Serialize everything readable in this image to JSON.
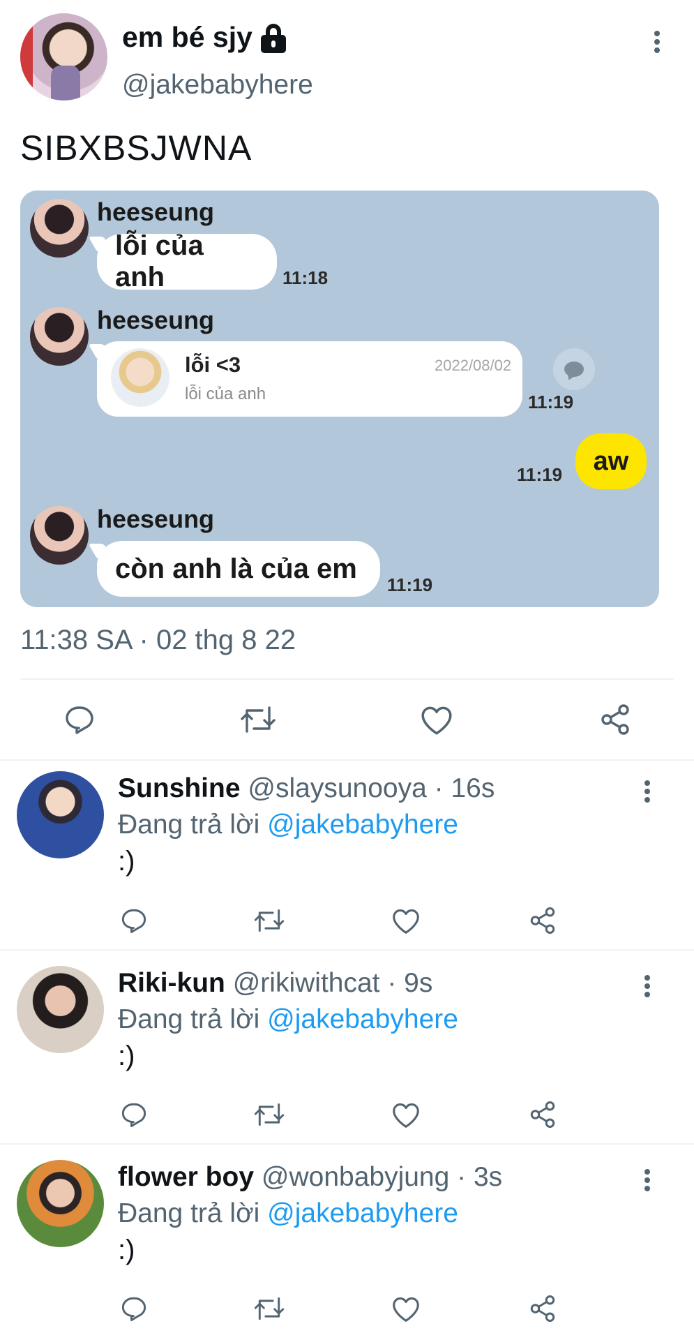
{
  "tweet": {
    "display_name": "em bé sjy",
    "handle": "@jakebabyhere",
    "text": "SIBXBSJWNA",
    "meta": "11:38 SA · 02 thg 8 22"
  },
  "chat": {
    "messages": [
      {
        "sender": "heeseung",
        "text": "lỗi của anh",
        "time": "11:18"
      },
      {
        "sender": "heeseung",
        "quote_title": "lỗi <3",
        "quote_subtitle": "lỗi của anh",
        "quote_date": "2022/08/02",
        "time": "11:19"
      },
      {
        "text": "aw",
        "time": "11:19"
      },
      {
        "sender": "heeseung",
        "text": "còn anh là của em",
        "time": "11:19"
      }
    ]
  },
  "replies": [
    {
      "name": "Sunshine",
      "handle": "@slaysunooya",
      "age": "· 16s",
      "replying_prefix": "Đang trả lời",
      "replying_to": "@jakebabyhere",
      "text": ":)"
    },
    {
      "name": "Riki-kun",
      "handle": "@rikiwithcat",
      "age": "· 9s",
      "replying_prefix": "Đang trả lời",
      "replying_to": "@jakebabyhere",
      "text": ":)"
    },
    {
      "name": "flower boy",
      "handle": "@wonbabyjung",
      "age": "· 3s",
      "replying_prefix": "Đang trả lời",
      "replying_to": "@jakebabyhere",
      "text": ":)"
    }
  ],
  "icons": {
    "reply": "reply-icon",
    "retweet": "retweet-icon",
    "like": "heart-icon",
    "share": "share-icon",
    "more": "more-vertical-icon",
    "lock": "lock-icon"
  },
  "colors": {
    "chat_background": "#b2c7da",
    "kakao_yellow": "#fee500",
    "mention_blue": "#1d9bf0",
    "muted_text": "#536471"
  }
}
